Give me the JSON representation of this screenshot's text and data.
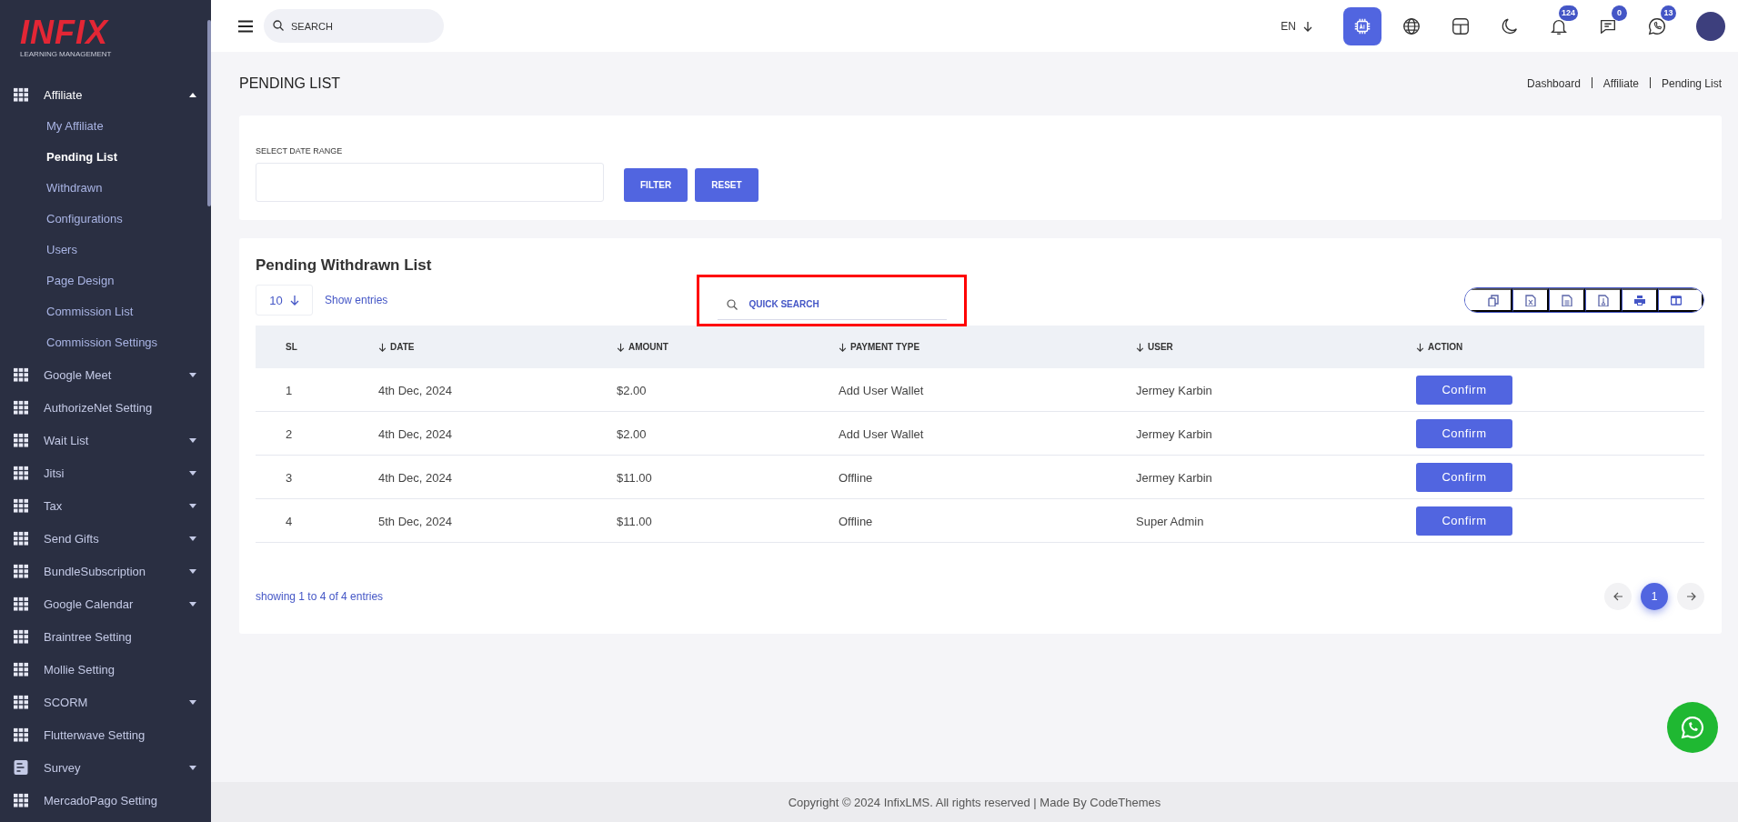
{
  "logo": {
    "brand": "INFIX",
    "tagline": "LEARNING MANAGEMENT"
  },
  "sidebar": {
    "items": [
      {
        "label": "Affiliate",
        "kind": "grid",
        "expandable": true,
        "expanded": true,
        "children": [
          {
            "label": "My Affiliate",
            "selected": false
          },
          {
            "label": "Pending List",
            "selected": true
          },
          {
            "label": "Withdrawn",
            "selected": false
          },
          {
            "label": "Configurations",
            "selected": false
          },
          {
            "label": "Users",
            "selected": false
          },
          {
            "label": "Page Design",
            "selected": false
          },
          {
            "label": "Commission List",
            "selected": false
          },
          {
            "label": "Commission Settings",
            "selected": false
          }
        ]
      },
      {
        "label": "Google Meet",
        "kind": "grid",
        "expandable": true,
        "expanded": false
      },
      {
        "label": "AuthorizeNet Setting",
        "kind": "grid",
        "expandable": false,
        "expanded": false
      },
      {
        "label": "Wait List",
        "kind": "grid",
        "expandable": true,
        "expanded": false
      },
      {
        "label": "Jitsi",
        "kind": "grid",
        "expandable": true,
        "expanded": false
      },
      {
        "label": "Tax",
        "kind": "grid",
        "expandable": true,
        "expanded": false
      },
      {
        "label": "Send Gifts",
        "kind": "grid",
        "expandable": true,
        "expanded": false
      },
      {
        "label": "BundleSubscription",
        "kind": "grid",
        "expandable": true,
        "expanded": false
      },
      {
        "label": "Google Calendar",
        "kind": "grid",
        "expandable": true,
        "expanded": false
      },
      {
        "label": "Braintree Setting",
        "kind": "grid",
        "expandable": false,
        "expanded": false
      },
      {
        "label": "Mollie Setting",
        "kind": "grid",
        "expandable": false,
        "expanded": false
      },
      {
        "label": "SCORM",
        "kind": "grid",
        "expandable": true,
        "expanded": false
      },
      {
        "label": "Flutterwave Setting",
        "kind": "grid",
        "expandable": false,
        "expanded": false
      },
      {
        "label": "Survey",
        "kind": "survey",
        "expandable": true,
        "expanded": false
      },
      {
        "label": "MercadoPago Setting",
        "kind": "grid",
        "expandable": false,
        "expanded": false
      }
    ]
  },
  "header": {
    "search": {
      "placeholder": "SEARCH"
    },
    "language": "EN",
    "icons": [
      {
        "kind": "chip",
        "selected": true
      },
      {
        "kind": "globe",
        "selected": false
      },
      {
        "kind": "layout",
        "selected": false
      },
      {
        "kind": "moon",
        "selected": false
      },
      {
        "kind": "bell",
        "selected": false,
        "badge": "124"
      },
      {
        "kind": "chat",
        "selected": false,
        "badge": "0"
      },
      {
        "kind": "phone",
        "selected": false,
        "badge": "13"
      }
    ]
  },
  "page": {
    "title": "PENDING LIST",
    "breadcrumbs": [
      "Dashboard",
      "Affiliate",
      "Pending List"
    ]
  },
  "filter": {
    "label": "SELECT DATE RANGE",
    "buttons": [
      "FILTER",
      "RESET"
    ]
  },
  "table": {
    "title": "Pending Withdrawn List",
    "page_size": "10",
    "page_size_label": "Show entries",
    "quick_search": {
      "placeholder": "QUICK SEARCH",
      "highlighted": true
    },
    "exports": [
      {
        "kind": "copy"
      },
      {
        "kind": "excel"
      },
      {
        "kind": "csv"
      },
      {
        "kind": "pdf"
      },
      {
        "kind": "print"
      },
      {
        "kind": "columns"
      }
    ],
    "columns": [
      {
        "label": "SL",
        "sortable": false
      },
      {
        "label": "DATE",
        "sortable": true
      },
      {
        "label": "AMOUNT",
        "sortable": true
      },
      {
        "label": "PAYMENT TYPE",
        "sortable": true
      },
      {
        "label": "USER",
        "sortable": true
      },
      {
        "label": "ACTION",
        "sortable": true
      }
    ],
    "rows": [
      {
        "sl": "1",
        "date": "4th Dec, 2024",
        "amount": "$2.00",
        "payment_type": "Add User Wallet",
        "user": "Jermey Karbin",
        "action": "Confirm"
      },
      {
        "sl": "2",
        "date": "4th Dec, 2024",
        "amount": "$2.00",
        "payment_type": "Add User Wallet",
        "user": "Jermey Karbin",
        "action": "Confirm"
      },
      {
        "sl": "3",
        "date": "4th Dec, 2024",
        "amount": "$11.00",
        "payment_type": "Offline",
        "user": "Jermey Karbin",
        "action": "Confirm"
      },
      {
        "sl": "4",
        "date": "5th Dec, 2024",
        "amount": "$11.00",
        "payment_type": "Offline",
        "user": "Super Admin",
        "action": "Confirm"
      }
    ],
    "summary": "showing 1 to 4 of 4 entries",
    "pages": [
      {
        "label": "1",
        "selected": true
      }
    ]
  },
  "footer": "Copyright © 2024 InfixLMS. All rights reserved | Made By CodeThemes"
}
